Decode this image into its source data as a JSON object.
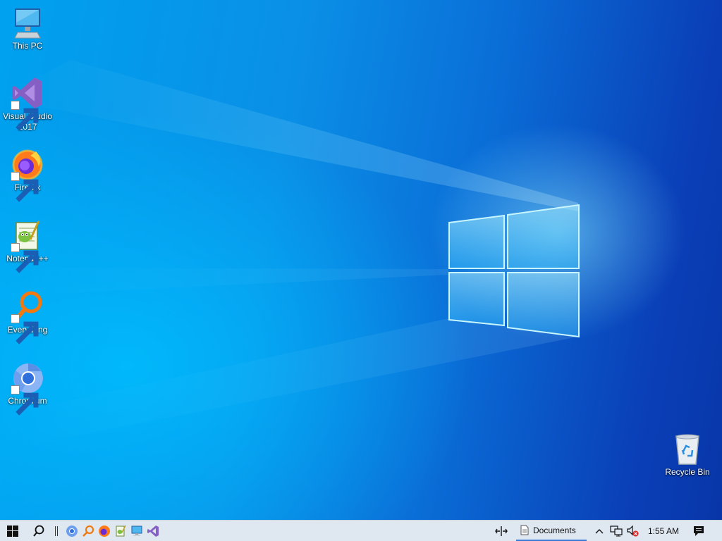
{
  "desktop": {
    "icons": [
      {
        "label": "This PC",
        "icon": "monitor-icon",
        "shortcut": false
      },
      {
        "label": "Visual Studio\n2017",
        "icon": "visual-studio-icon",
        "shortcut": true
      },
      {
        "label": "Firefox",
        "icon": "firefox-icon",
        "shortcut": true
      },
      {
        "label": "Notepad++",
        "icon": "notepad-plus-plus-icon",
        "shortcut": true
      },
      {
        "label": "Everything",
        "icon": "magnifier-icon",
        "shortcut": true
      },
      {
        "label": "Chromium",
        "icon": "chromium-icon",
        "shortcut": true
      },
      {
        "label": "Recycle Bin",
        "icon": "recycle-bin-icon",
        "shortcut": false
      }
    ],
    "wallpaper": {
      "accent": "#00a2ef",
      "deep": "#0836a8"
    }
  },
  "taskbar": {
    "pinned": [
      "start-icon",
      "search-icon",
      "chromium-icon",
      "everything-icon",
      "firefox-icon",
      "notepad-plus-plus-icon",
      "this-pc-icon",
      "visual-studio-icon"
    ],
    "toolbar_label": "Documents",
    "clock": "1:55 AM",
    "tray": [
      "show-hidden-icons-chevron-icon",
      "network-icon",
      "volume-muted-icon",
      "action-center-icon"
    ],
    "background": "#dfe8f1"
  }
}
